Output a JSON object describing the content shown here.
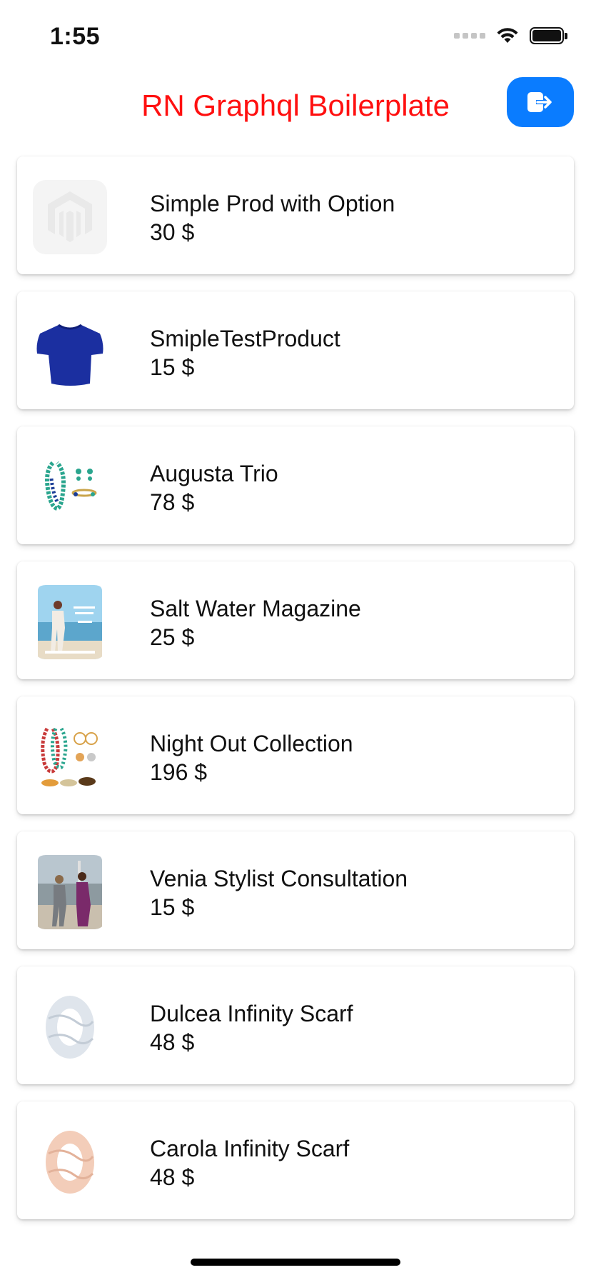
{
  "status_bar": {
    "time": "1:55"
  },
  "header": {
    "title": "RN Graphql Boilerplate",
    "logout_icon": "logout-icon"
  },
  "products": [
    {
      "name": "Simple Prod with Option",
      "price": "30 $",
      "image": "magento-placeholder-icon"
    },
    {
      "name": "SmipleTestProduct",
      "price": "15 $",
      "image": "blue-tshirt-image"
    },
    {
      "name": "Augusta Trio",
      "price": "78 $",
      "image": "jewelry-set-image"
    },
    {
      "name": "Salt Water Magazine",
      "price": "25 $",
      "image": "magazine-cover-image"
    },
    {
      "name": "Night Out Collection",
      "price": "196 $",
      "image": "jewelry-collection-image"
    },
    {
      "name": "Venia Stylist Consultation",
      "price": "15 $",
      "image": "beach-photo-image"
    },
    {
      "name": "Dulcea Infinity Scarf",
      "price": "48 $",
      "image": "grey-scarf-image"
    },
    {
      "name": "Carola Infinity Scarf",
      "price": "48 $",
      "image": "peach-scarf-image"
    }
  ],
  "colors": {
    "title": "#ff1010",
    "accent": "#0a7cff"
  }
}
